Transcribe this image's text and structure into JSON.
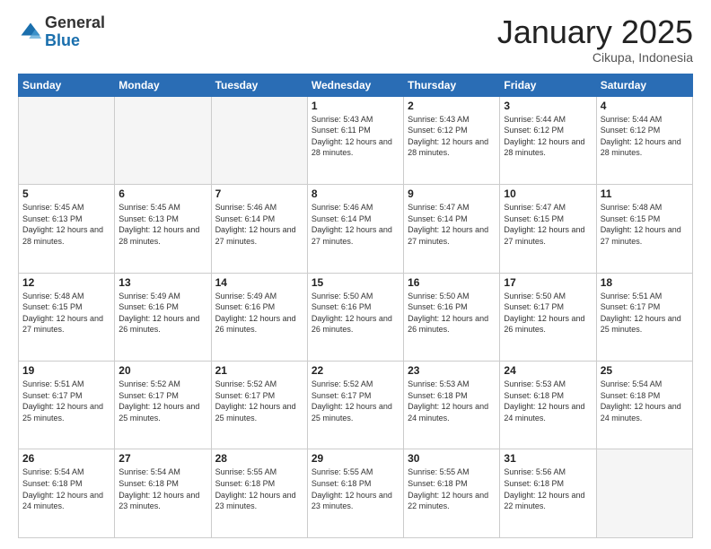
{
  "logo": {
    "general": "General",
    "blue": "Blue"
  },
  "header": {
    "month": "January 2025",
    "location": "Cikupa, Indonesia"
  },
  "weekdays": [
    "Sunday",
    "Monday",
    "Tuesday",
    "Wednesday",
    "Thursday",
    "Friday",
    "Saturday"
  ],
  "weeks": [
    [
      {
        "day": "",
        "sunrise": "",
        "sunset": "",
        "daylight": ""
      },
      {
        "day": "",
        "sunrise": "",
        "sunset": "",
        "daylight": ""
      },
      {
        "day": "",
        "sunrise": "",
        "sunset": "",
        "daylight": ""
      },
      {
        "day": "1",
        "sunrise": "Sunrise: 5:43 AM",
        "sunset": "Sunset: 6:11 PM",
        "daylight": "Daylight: 12 hours and 28 minutes."
      },
      {
        "day": "2",
        "sunrise": "Sunrise: 5:43 AM",
        "sunset": "Sunset: 6:12 PM",
        "daylight": "Daylight: 12 hours and 28 minutes."
      },
      {
        "day": "3",
        "sunrise": "Sunrise: 5:44 AM",
        "sunset": "Sunset: 6:12 PM",
        "daylight": "Daylight: 12 hours and 28 minutes."
      },
      {
        "day": "4",
        "sunrise": "Sunrise: 5:44 AM",
        "sunset": "Sunset: 6:12 PM",
        "daylight": "Daylight: 12 hours and 28 minutes."
      }
    ],
    [
      {
        "day": "5",
        "sunrise": "Sunrise: 5:45 AM",
        "sunset": "Sunset: 6:13 PM",
        "daylight": "Daylight: 12 hours and 28 minutes."
      },
      {
        "day": "6",
        "sunrise": "Sunrise: 5:45 AM",
        "sunset": "Sunset: 6:13 PM",
        "daylight": "Daylight: 12 hours and 28 minutes."
      },
      {
        "day": "7",
        "sunrise": "Sunrise: 5:46 AM",
        "sunset": "Sunset: 6:14 PM",
        "daylight": "Daylight: 12 hours and 27 minutes."
      },
      {
        "day": "8",
        "sunrise": "Sunrise: 5:46 AM",
        "sunset": "Sunset: 6:14 PM",
        "daylight": "Daylight: 12 hours and 27 minutes."
      },
      {
        "day": "9",
        "sunrise": "Sunrise: 5:47 AM",
        "sunset": "Sunset: 6:14 PM",
        "daylight": "Daylight: 12 hours and 27 minutes."
      },
      {
        "day": "10",
        "sunrise": "Sunrise: 5:47 AM",
        "sunset": "Sunset: 6:15 PM",
        "daylight": "Daylight: 12 hours and 27 minutes."
      },
      {
        "day": "11",
        "sunrise": "Sunrise: 5:48 AM",
        "sunset": "Sunset: 6:15 PM",
        "daylight": "Daylight: 12 hours and 27 minutes."
      }
    ],
    [
      {
        "day": "12",
        "sunrise": "Sunrise: 5:48 AM",
        "sunset": "Sunset: 6:15 PM",
        "daylight": "Daylight: 12 hours and 27 minutes."
      },
      {
        "day": "13",
        "sunrise": "Sunrise: 5:49 AM",
        "sunset": "Sunset: 6:16 PM",
        "daylight": "Daylight: 12 hours and 26 minutes."
      },
      {
        "day": "14",
        "sunrise": "Sunrise: 5:49 AM",
        "sunset": "Sunset: 6:16 PM",
        "daylight": "Daylight: 12 hours and 26 minutes."
      },
      {
        "day": "15",
        "sunrise": "Sunrise: 5:50 AM",
        "sunset": "Sunset: 6:16 PM",
        "daylight": "Daylight: 12 hours and 26 minutes."
      },
      {
        "day": "16",
        "sunrise": "Sunrise: 5:50 AM",
        "sunset": "Sunset: 6:16 PM",
        "daylight": "Daylight: 12 hours and 26 minutes."
      },
      {
        "day": "17",
        "sunrise": "Sunrise: 5:50 AM",
        "sunset": "Sunset: 6:17 PM",
        "daylight": "Daylight: 12 hours and 26 minutes."
      },
      {
        "day": "18",
        "sunrise": "Sunrise: 5:51 AM",
        "sunset": "Sunset: 6:17 PM",
        "daylight": "Daylight: 12 hours and 25 minutes."
      }
    ],
    [
      {
        "day": "19",
        "sunrise": "Sunrise: 5:51 AM",
        "sunset": "Sunset: 6:17 PM",
        "daylight": "Daylight: 12 hours and 25 minutes."
      },
      {
        "day": "20",
        "sunrise": "Sunrise: 5:52 AM",
        "sunset": "Sunset: 6:17 PM",
        "daylight": "Daylight: 12 hours and 25 minutes."
      },
      {
        "day": "21",
        "sunrise": "Sunrise: 5:52 AM",
        "sunset": "Sunset: 6:17 PM",
        "daylight": "Daylight: 12 hours and 25 minutes."
      },
      {
        "day": "22",
        "sunrise": "Sunrise: 5:52 AM",
        "sunset": "Sunset: 6:17 PM",
        "daylight": "Daylight: 12 hours and 25 minutes."
      },
      {
        "day": "23",
        "sunrise": "Sunrise: 5:53 AM",
        "sunset": "Sunset: 6:18 PM",
        "daylight": "Daylight: 12 hours and 24 minutes."
      },
      {
        "day": "24",
        "sunrise": "Sunrise: 5:53 AM",
        "sunset": "Sunset: 6:18 PM",
        "daylight": "Daylight: 12 hours and 24 minutes."
      },
      {
        "day": "25",
        "sunrise": "Sunrise: 5:54 AM",
        "sunset": "Sunset: 6:18 PM",
        "daylight": "Daylight: 12 hours and 24 minutes."
      }
    ],
    [
      {
        "day": "26",
        "sunrise": "Sunrise: 5:54 AM",
        "sunset": "Sunset: 6:18 PM",
        "daylight": "Daylight: 12 hours and 24 minutes."
      },
      {
        "day": "27",
        "sunrise": "Sunrise: 5:54 AM",
        "sunset": "Sunset: 6:18 PM",
        "daylight": "Daylight: 12 hours and 23 minutes."
      },
      {
        "day": "28",
        "sunrise": "Sunrise: 5:55 AM",
        "sunset": "Sunset: 6:18 PM",
        "daylight": "Daylight: 12 hours and 23 minutes."
      },
      {
        "day": "29",
        "sunrise": "Sunrise: 5:55 AM",
        "sunset": "Sunset: 6:18 PM",
        "daylight": "Daylight: 12 hours and 23 minutes."
      },
      {
        "day": "30",
        "sunrise": "Sunrise: 5:55 AM",
        "sunset": "Sunset: 6:18 PM",
        "daylight": "Daylight: 12 hours and 22 minutes."
      },
      {
        "day": "31",
        "sunrise": "Sunrise: 5:56 AM",
        "sunset": "Sunset: 6:18 PM",
        "daylight": "Daylight: 12 hours and 22 minutes."
      },
      {
        "day": "",
        "sunrise": "",
        "sunset": "",
        "daylight": ""
      }
    ]
  ]
}
